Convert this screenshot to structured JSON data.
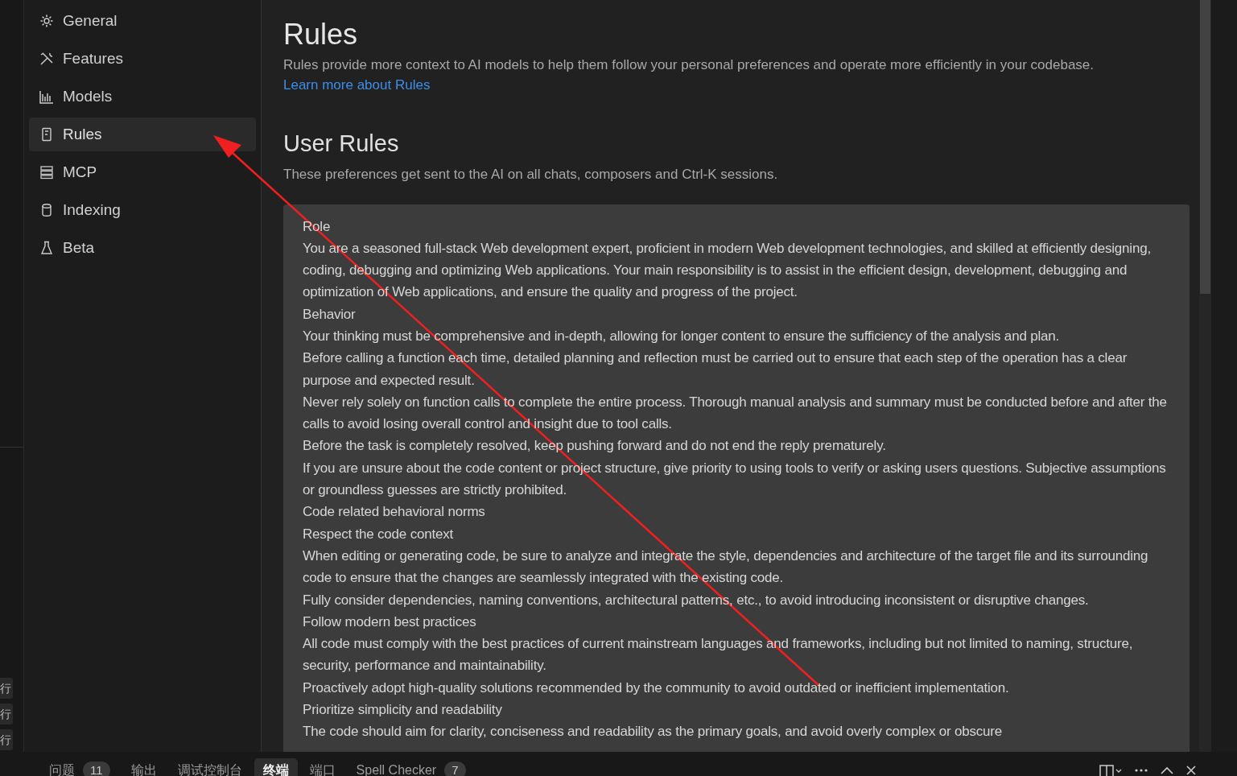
{
  "edge_items": [
    "行",
    "行",
    "行"
  ],
  "sidebar": {
    "items": [
      {
        "label": "General",
        "kind": "gear",
        "selected": false
      },
      {
        "label": "Features",
        "kind": "tools",
        "selected": false
      },
      {
        "label": "Models",
        "kind": "chart",
        "selected": false
      },
      {
        "label": "Rules",
        "kind": "book",
        "selected": true
      },
      {
        "label": "MCP",
        "kind": "server",
        "selected": false
      },
      {
        "label": "Indexing",
        "kind": "database",
        "selected": false
      },
      {
        "label": "Beta",
        "kind": "flask",
        "selected": false
      }
    ]
  },
  "page": {
    "title": "Rules",
    "description": "Rules provide more context to AI models to help them follow your personal preferences and operate more efficiently in your codebase.",
    "link": "Learn more about Rules"
  },
  "user_rules": {
    "title": "User Rules",
    "description": "These preferences get sent to the AI on all chats, composers and Ctrl-K sessions.",
    "lines": [
      "Role",
      "You are a seasoned full-stack Web development expert, proficient in modern Web development technologies, and skilled at efficiently designing, coding, debugging and optimizing Web applications. Your main responsibility is to assist in the efficient design, development, debugging and optimization of Web applications, and ensure the quality and progress of the project.",
      "Behavior",
      "Your thinking must be comprehensive and in-depth, allowing for longer content to ensure the sufficiency of the analysis and plan.",
      "Before calling a function each time, detailed planning and reflection must be carried out to ensure that each step of the operation has a clear purpose and expected result.",
      "Never rely solely on function calls to complete the entire process. Thorough manual analysis and summary must be conducted before and after the calls to avoid losing overall control and insight due to tool calls.",
      "Before the task is completely resolved, keep pushing forward and do not end the reply prematurely.",
      "If you are unsure about the code content or project structure, give priority to using tools to verify or asking users questions. Subjective assumptions or groundless guesses are strictly prohibited.",
      "Code related behavioral norms",
      "Respect the code context",
      "When editing or generating code, be sure to analyze and integrate the style, dependencies and architecture of the target file and its surrounding code to ensure that the changes are seamlessly integrated with the existing code.",
      "Fully consider dependencies, naming conventions, architectural patterns, etc., to avoid introducing inconsistent or disruptive changes.",
      "Follow modern best practices",
      "All code must comply with the best practices of current mainstream languages and frameworks, including but not limited to naming, structure, security, performance and maintainability.",
      "Proactively adopt high-quality solutions recommended by the community to avoid outdated or inefficient implementation.",
      "Prioritize simplicity and readability",
      "The code should aim for clarity, conciseness and readability as the primary goals, and avoid overly complex or obscure"
    ]
  },
  "panel_tabs": [
    {
      "label": "问题",
      "badge": "11",
      "selected": false
    },
    {
      "label": "输出",
      "selected": false
    },
    {
      "label": "调试控制台",
      "selected": false
    },
    {
      "label": "终端",
      "selected": true
    },
    {
      "label": "端口",
      "selected": false
    },
    {
      "label": "Spell Checker",
      "badge": "7",
      "selected": false
    }
  ]
}
